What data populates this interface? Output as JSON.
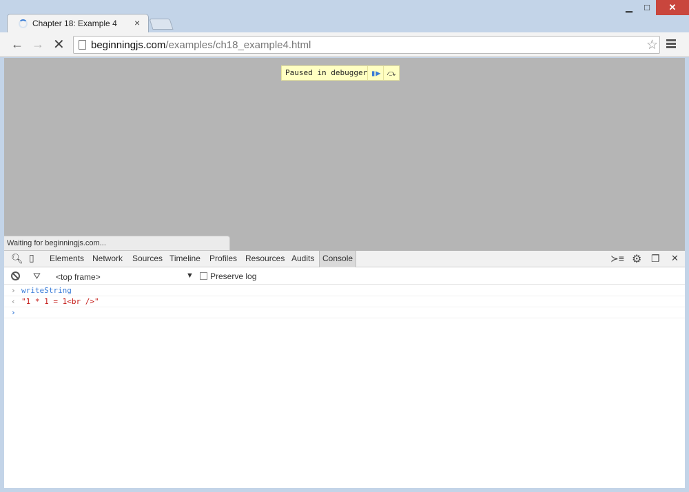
{
  "window": {
    "controls": {
      "minimize": "▁",
      "maximize": "□",
      "close": "✕"
    }
  },
  "tab": {
    "title": "Chapter 18: Example 4",
    "close": "×"
  },
  "toolbar": {
    "url_domain": "beginningjs.com",
    "url_path": "/examples/ch18_example4.html"
  },
  "page": {
    "paused_text": "Paused in debugger",
    "status_text": "Waiting for beginningjs.com..."
  },
  "devtools": {
    "tabs": [
      "Elements",
      "Network",
      "Sources",
      "Timeline",
      "Profiles",
      "Resources",
      "Audits",
      "Console"
    ],
    "active_tab": "Console",
    "frame_select": "<top frame>",
    "preserve_log_label": "Preserve log",
    "preserve_log_checked": false,
    "console_lines": [
      {
        "type": "command",
        "text": "writeString"
      },
      {
        "type": "result",
        "text": "\"1 * 1 = 1<br />\""
      }
    ]
  }
}
